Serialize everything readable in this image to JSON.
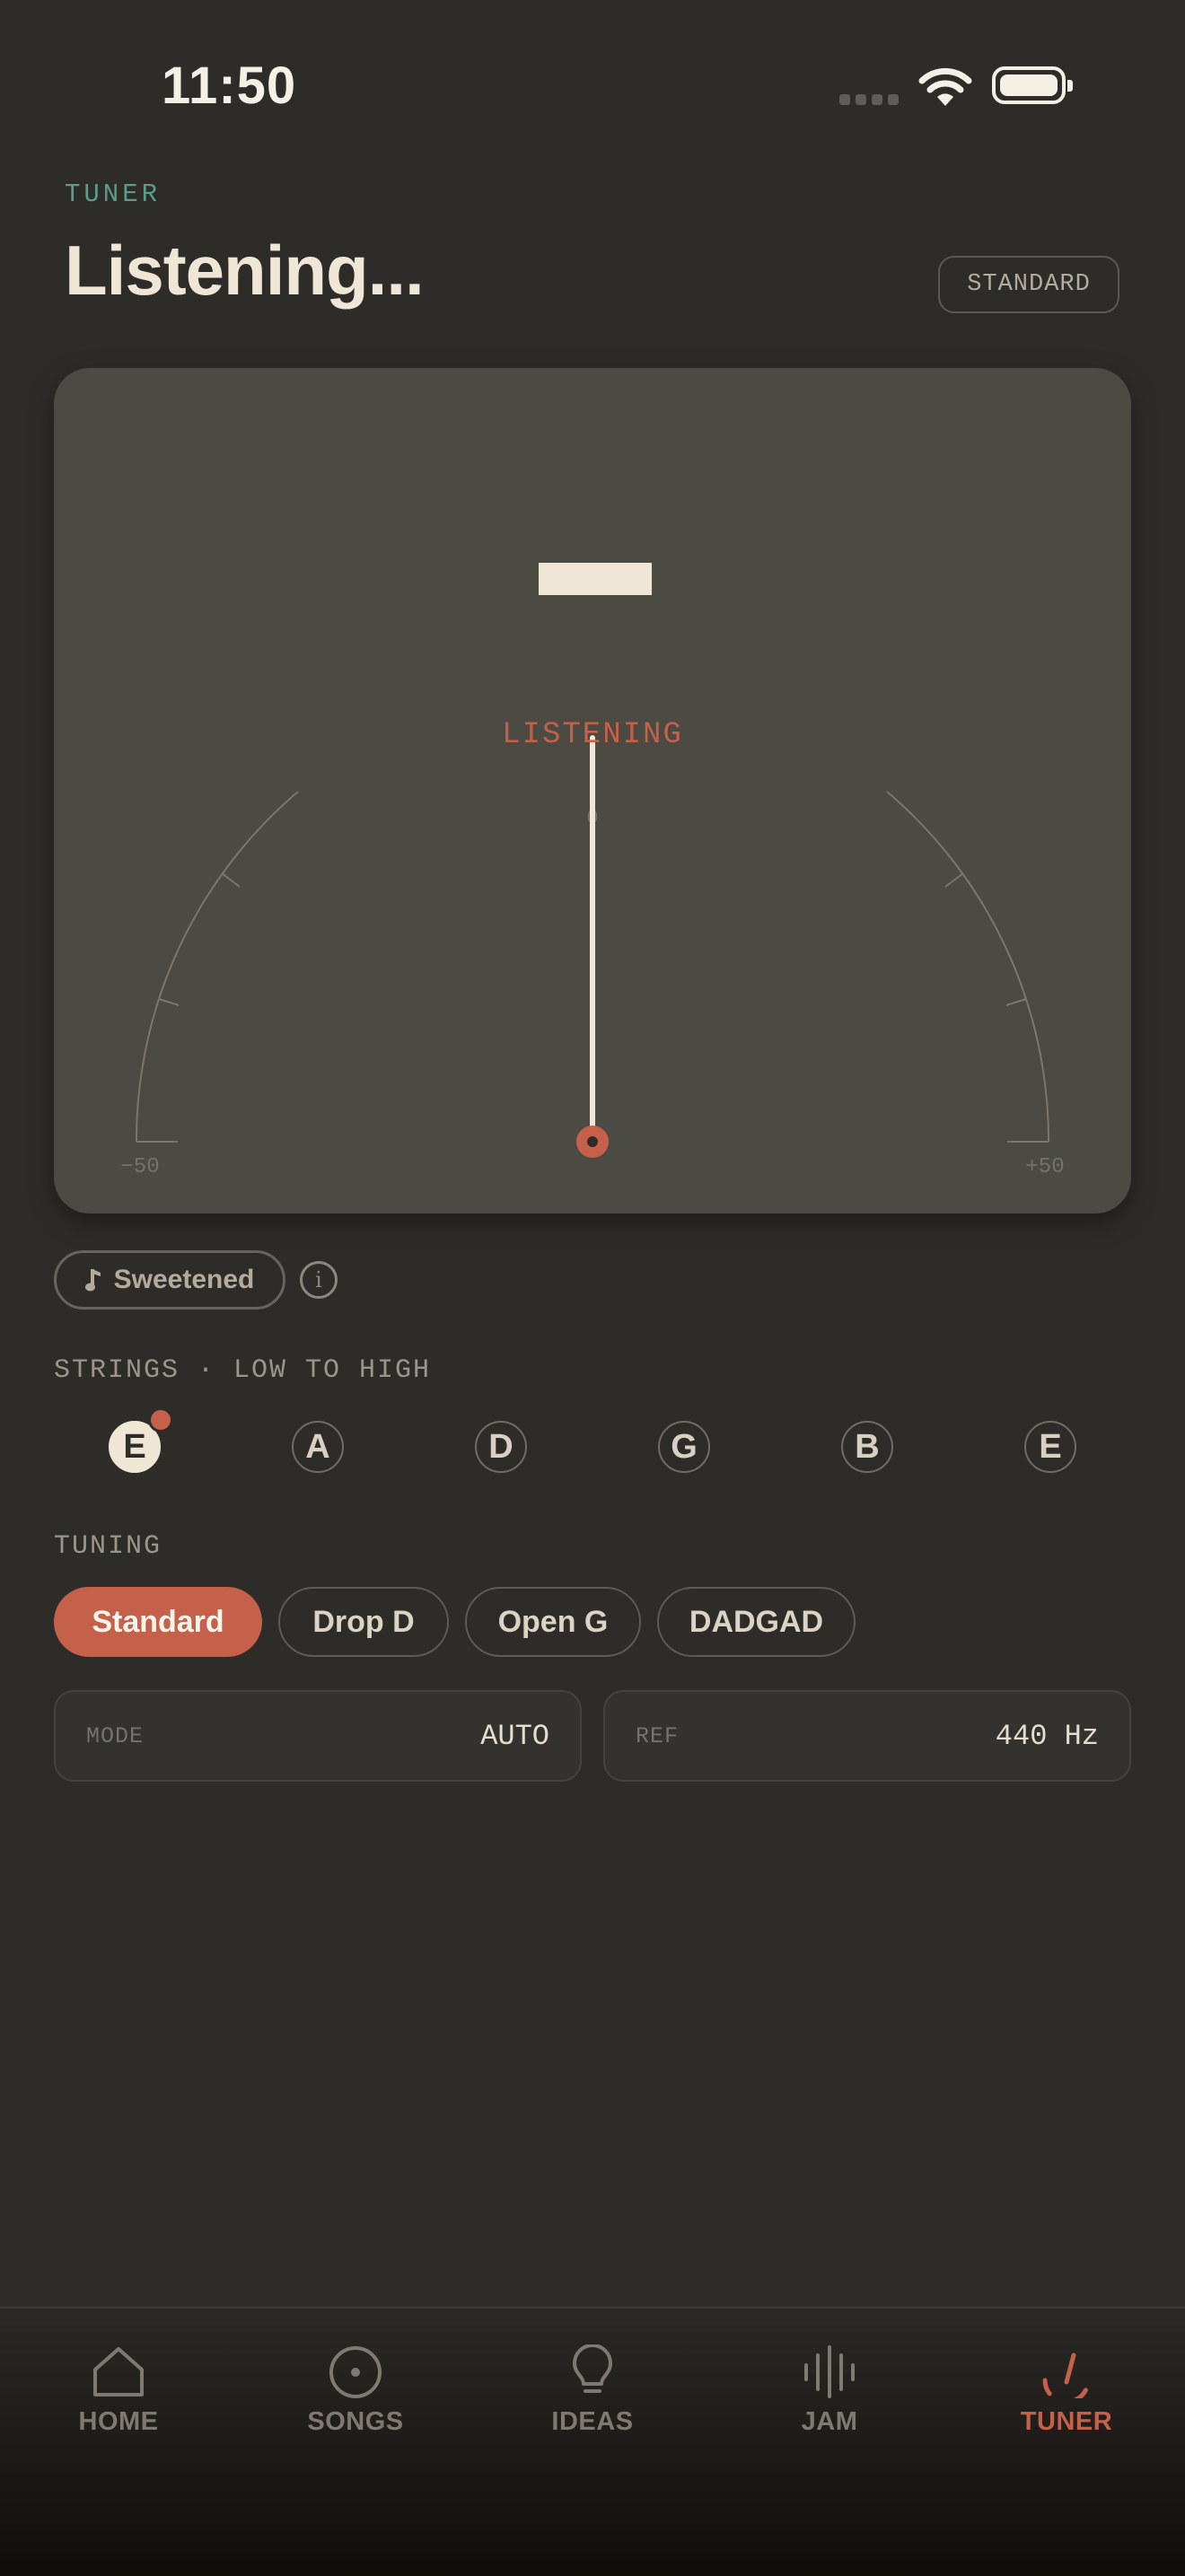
{
  "status_bar": {
    "time": "11:50"
  },
  "header": {
    "eyebrow": "TUNER",
    "title": "Listening...",
    "tuning_badge": "STANDARD"
  },
  "gauge": {
    "state_label": "LISTENING",
    "center_tick": "0",
    "min_label": "−50",
    "max_label": "+50",
    "needle_cents": 0,
    "colors": {
      "accent": "#c5604b",
      "needle": "#efe6d6"
    }
  },
  "temperament": {
    "label": "Sweetened",
    "icon": "music-note-icon",
    "info_icon": "info-icon"
  },
  "strings": {
    "section_label": "STRINGS · LOW TO HIGH",
    "items": [
      {
        "note": "E",
        "active": true
      },
      {
        "note": "A",
        "active": false
      },
      {
        "note": "D",
        "active": false
      },
      {
        "note": "G",
        "active": false
      },
      {
        "note": "B",
        "active": false
      },
      {
        "note": "E",
        "active": false
      }
    ]
  },
  "tuning": {
    "section_label": "TUNING",
    "options": [
      {
        "label": "Standard",
        "selected": true
      },
      {
        "label": "Drop D",
        "selected": false
      },
      {
        "label": "Open G",
        "selected": false
      },
      {
        "label": "DADGAD",
        "selected": false
      }
    ]
  },
  "settings": {
    "mode": {
      "label": "MODE",
      "value": "AUTO"
    },
    "ref": {
      "label": "REF",
      "value": "440 Hz"
    }
  },
  "tabbar": {
    "items": [
      {
        "label": "HOME",
        "icon": "home-icon",
        "active": false
      },
      {
        "label": "SONGS",
        "icon": "disc-icon",
        "active": false
      },
      {
        "label": "IDEAS",
        "icon": "lightbulb-icon",
        "active": false
      },
      {
        "label": "JAM",
        "icon": "waveform-icon",
        "active": false
      },
      {
        "label": "TUNER",
        "icon": "tuner-icon",
        "active": true
      }
    ]
  }
}
